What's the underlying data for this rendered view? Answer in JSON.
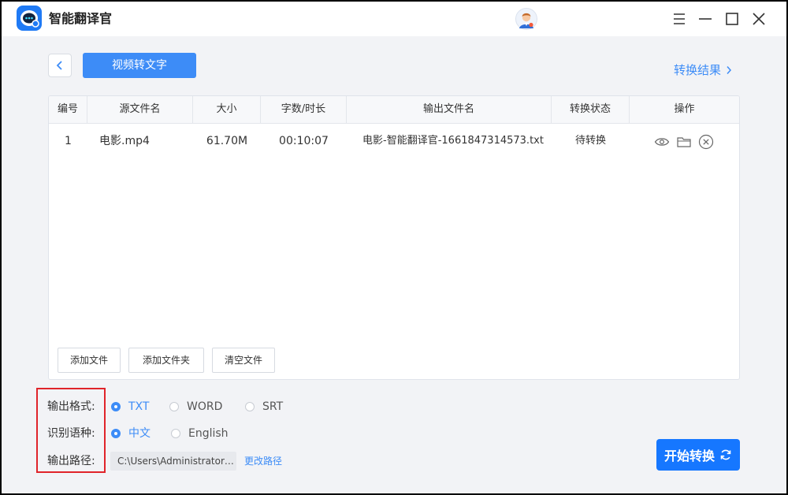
{
  "app": {
    "title": "智能翻译官"
  },
  "header": {
    "mode_tab": "视频转文字",
    "result_link": "转换结果"
  },
  "table": {
    "headers": [
      "编号",
      "源文件名",
      "大小",
      "字数/时长",
      "输出文件名",
      "转换状态",
      "操作"
    ],
    "rows": [
      {
        "id": "1",
        "source": "电影.mp4",
        "size": "61.70M",
        "duration": "00:10:07",
        "output": "电影-智能翻译官-1661847314573.txt",
        "status": "待转换"
      }
    ]
  },
  "panel_buttons": {
    "add_file": "添加文件",
    "add_folder": "添加文件夹",
    "clear": "清空文件"
  },
  "options": {
    "format_label": "输出格式:",
    "formats": [
      "TXT",
      "WORD",
      "SRT"
    ],
    "lang_label": "识别语种:",
    "languages": [
      "中文",
      "English"
    ],
    "path_label": "输出路径:",
    "path_value": "C:\\Users\\Administrator\\Desktop",
    "change_path": "更改路径"
  },
  "start_button": "开始转换",
  "colors": {
    "accent": "#3d8cf7",
    "start": "#1677ff",
    "highlight": "#e0242a"
  }
}
